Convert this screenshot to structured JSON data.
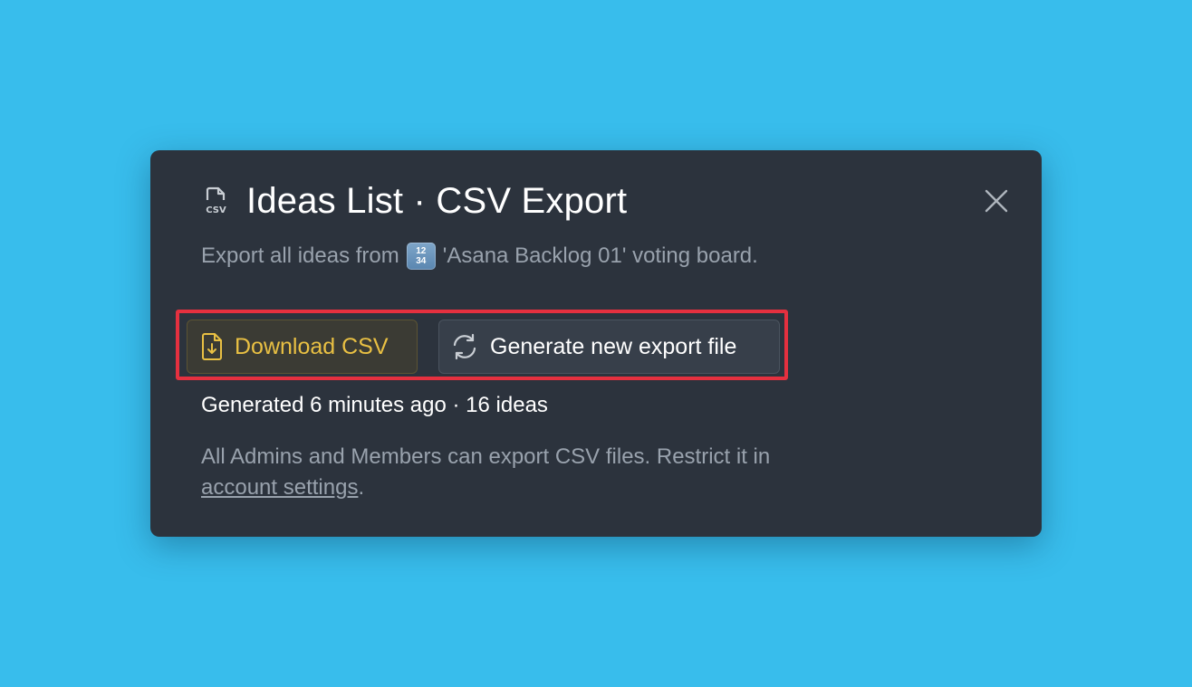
{
  "modal": {
    "title": "Ideas List · CSV Export",
    "title_icon": "csv-file-icon",
    "close_icon": "close-icon",
    "subtitle_prefix": "Export all ideas from",
    "board_emoji_top": "12",
    "board_emoji_bottom": "34",
    "subtitle_suffix": "'Asana Backlog 01' voting board.",
    "buttons": {
      "download_label": "Download CSV",
      "download_icon": "file-download-icon",
      "generate_label": "Generate new export file",
      "generate_icon": "refresh-icon"
    },
    "status": "Generated 6 minutes ago · 16 ideas",
    "footnote_text": "All Admins and Members can export CSV files. Restrict it in",
    "footnote_link": "account settings",
    "footnote_end": "."
  },
  "colors": {
    "background": "#38bdec",
    "modal": "#2c333d",
    "download_accent": "#e9c043",
    "highlight": "#e5303f"
  }
}
